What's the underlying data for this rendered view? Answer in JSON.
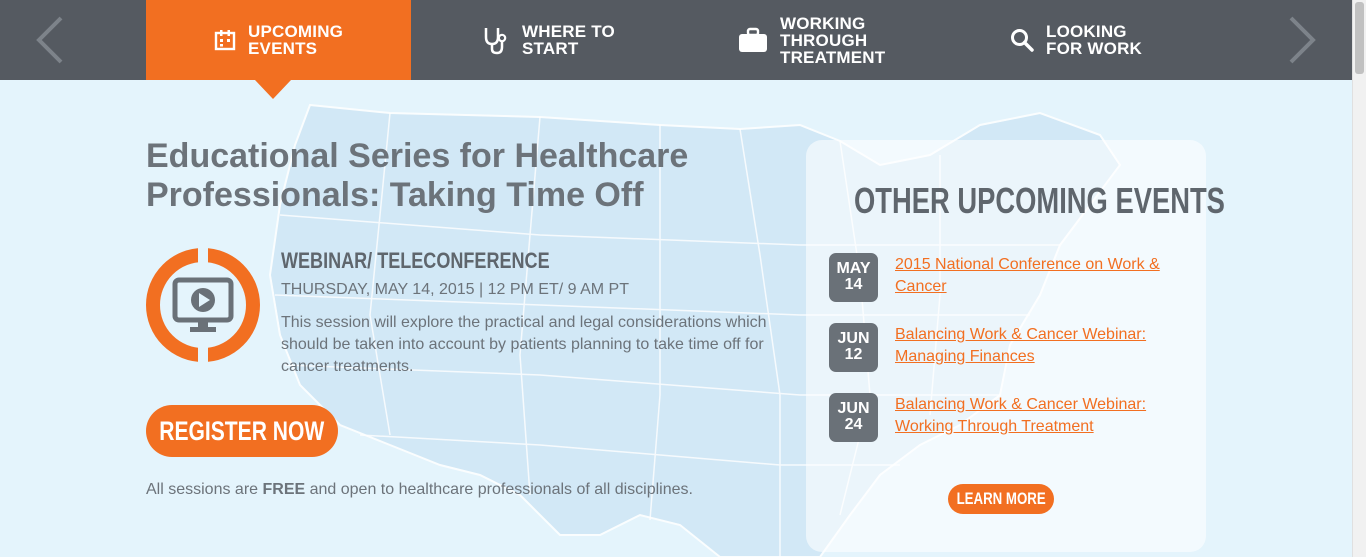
{
  "nav": {
    "tabs": [
      {
        "label": "UPCOMING\nEVENTS",
        "icon": "calendar-icon",
        "active": true
      },
      {
        "label": "WHERE TO\nSTART",
        "icon": "stethoscope-icon",
        "active": false
      },
      {
        "label": "WORKING\nTHROUGH\nTREATMENT",
        "icon": "briefcase-icon",
        "active": false
      },
      {
        "label": "LOOKING\nFOR WORK",
        "icon": "search-icon",
        "active": false
      }
    ],
    "prev_icon": "chevron-left-icon",
    "next_icon": "chevron-right-icon"
  },
  "event": {
    "title": "Educational Series for Healthcare Professionals: Taking Time Off",
    "icon": "webinar-monitor-icon",
    "type": "WEBINAR/ TELECONFERENCE",
    "date": "THURSDAY, MAY 14, 2015 | 12 PM ET/ 9 AM PT",
    "description": "This session will explore the practical and legal considerations which should be taken into account by patients planning to take time off for cancer treatments.",
    "register_label": "REGISTER NOW",
    "note_prefix": "All sessions are ",
    "note_bold": "FREE",
    "note_suffix": " and open to healthcare professionals of all disciplines."
  },
  "sidebar": {
    "heading": "OTHER UPCOMING EVENTS",
    "events": [
      {
        "month": "MAY",
        "day": "14",
        "title": "2015 National Conference on Work & Cancer"
      },
      {
        "month": "JUN",
        "day": "12",
        "title": "Balancing Work & Cancer Webinar: Managing Finances"
      },
      {
        "month": "JUN",
        "day": "24",
        "title": "Balancing Work & Cancer Webinar: Working Through Treatment"
      }
    ],
    "learn_more_label": "LEARN MORE"
  },
  "colors": {
    "accent": "#f26f21",
    "nav_bg": "#555a61",
    "page_bg": "#e4f4fc",
    "text": "#6c737a",
    "badge": "#6a7178"
  }
}
